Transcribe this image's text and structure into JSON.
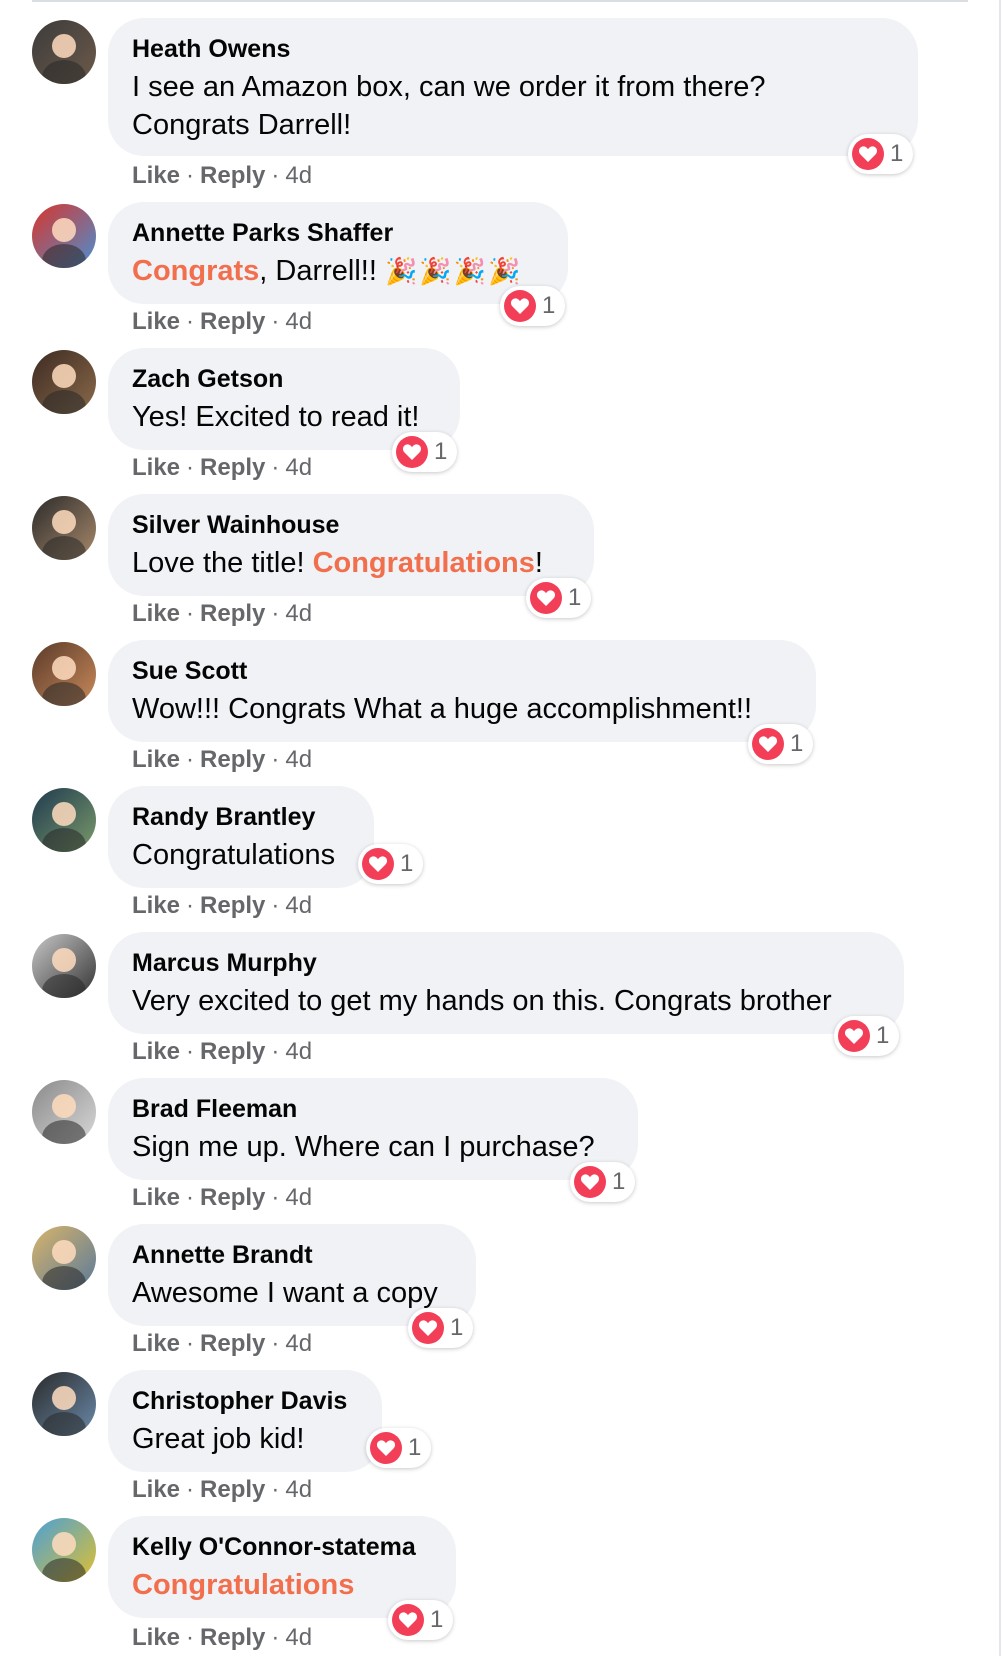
{
  "actions": {
    "like": "Like",
    "reply": "Reply",
    "separator": "·"
  },
  "colors": {
    "highlight": "#f26f4e",
    "heart": "#f33e58",
    "bubble": "#f0f2f5",
    "meta": "#65676b"
  },
  "comments": [
    {
      "author": "Heath Owens",
      "text_parts": [
        "I see an Amazon box, can we order it from there?",
        "Congrats Darrell!"
      ],
      "reactions": "1",
      "time": "4d",
      "avatar_colors": [
        "#3b3b3b",
        "#6d5a4a"
      ]
    },
    {
      "author": "Annette Parks Shaffer",
      "highlight": "Congrats",
      "text_after": ", Darrell!! ",
      "emoji": "🎉🎉🎉🎉",
      "reactions": "1",
      "time": "4d",
      "avatar_colors": [
        "#d9352b",
        "#4a8fd1"
      ]
    },
    {
      "author": "Zach Getson",
      "text": "Yes! Excited to read it!",
      "reactions": "1",
      "time": "4d",
      "avatar_colors": [
        "#3d2a22",
        "#8a6a4a"
      ]
    },
    {
      "author": "Silver Wainhouse",
      "text_before": "Love the title! ",
      "highlight": "Congratulations",
      "text_after": "!",
      "reactions": "1",
      "time": "4d",
      "avatar_colors": [
        "#2b2b2b",
        "#a8896a"
      ]
    },
    {
      "author": "Sue Scott",
      "text": "Wow!!! Congrats What a huge accomplishment!!",
      "reactions": "1",
      "time": "4d",
      "avatar_colors": [
        "#5a3a2a",
        "#c98a5a"
      ]
    },
    {
      "author": "Randy Brantley",
      "text": "Congratulations",
      "reactions": "1",
      "time": "4d",
      "avatar_colors": [
        "#1f3a4f",
        "#7a9a6a"
      ]
    },
    {
      "author": "Marcus Murphy",
      "text": "Very excited to get my hands on this. Congrats brother",
      "reactions": "1",
      "time": "4d",
      "avatar_colors": [
        "#c7c7c7",
        "#333333"
      ]
    },
    {
      "author": "Brad Fleeman",
      "text": "Sign me up. Where can I purchase?",
      "reactions": "1",
      "time": "4d",
      "avatar_colors": [
        "#8a8a8a",
        "#d8d8d8"
      ]
    },
    {
      "author": "Annette Brandt",
      "text": "Awesome I want a copy",
      "reactions": "1",
      "time": "4d",
      "avatar_colors": [
        "#d8b46a",
        "#5a7a9a"
      ]
    },
    {
      "author": "Christopher Davis",
      "text": "Great job kid!",
      "reactions": "1",
      "time": "4d",
      "avatar_colors": [
        "#2a2a2a",
        "#6a8aaa"
      ]
    },
    {
      "author": "Kelly O'Connor-statema",
      "highlight": "Congratulations",
      "reactions": "1",
      "time": "4d",
      "avatar_colors": [
        "#4aa0d8",
        "#e0c030"
      ]
    }
  ]
}
